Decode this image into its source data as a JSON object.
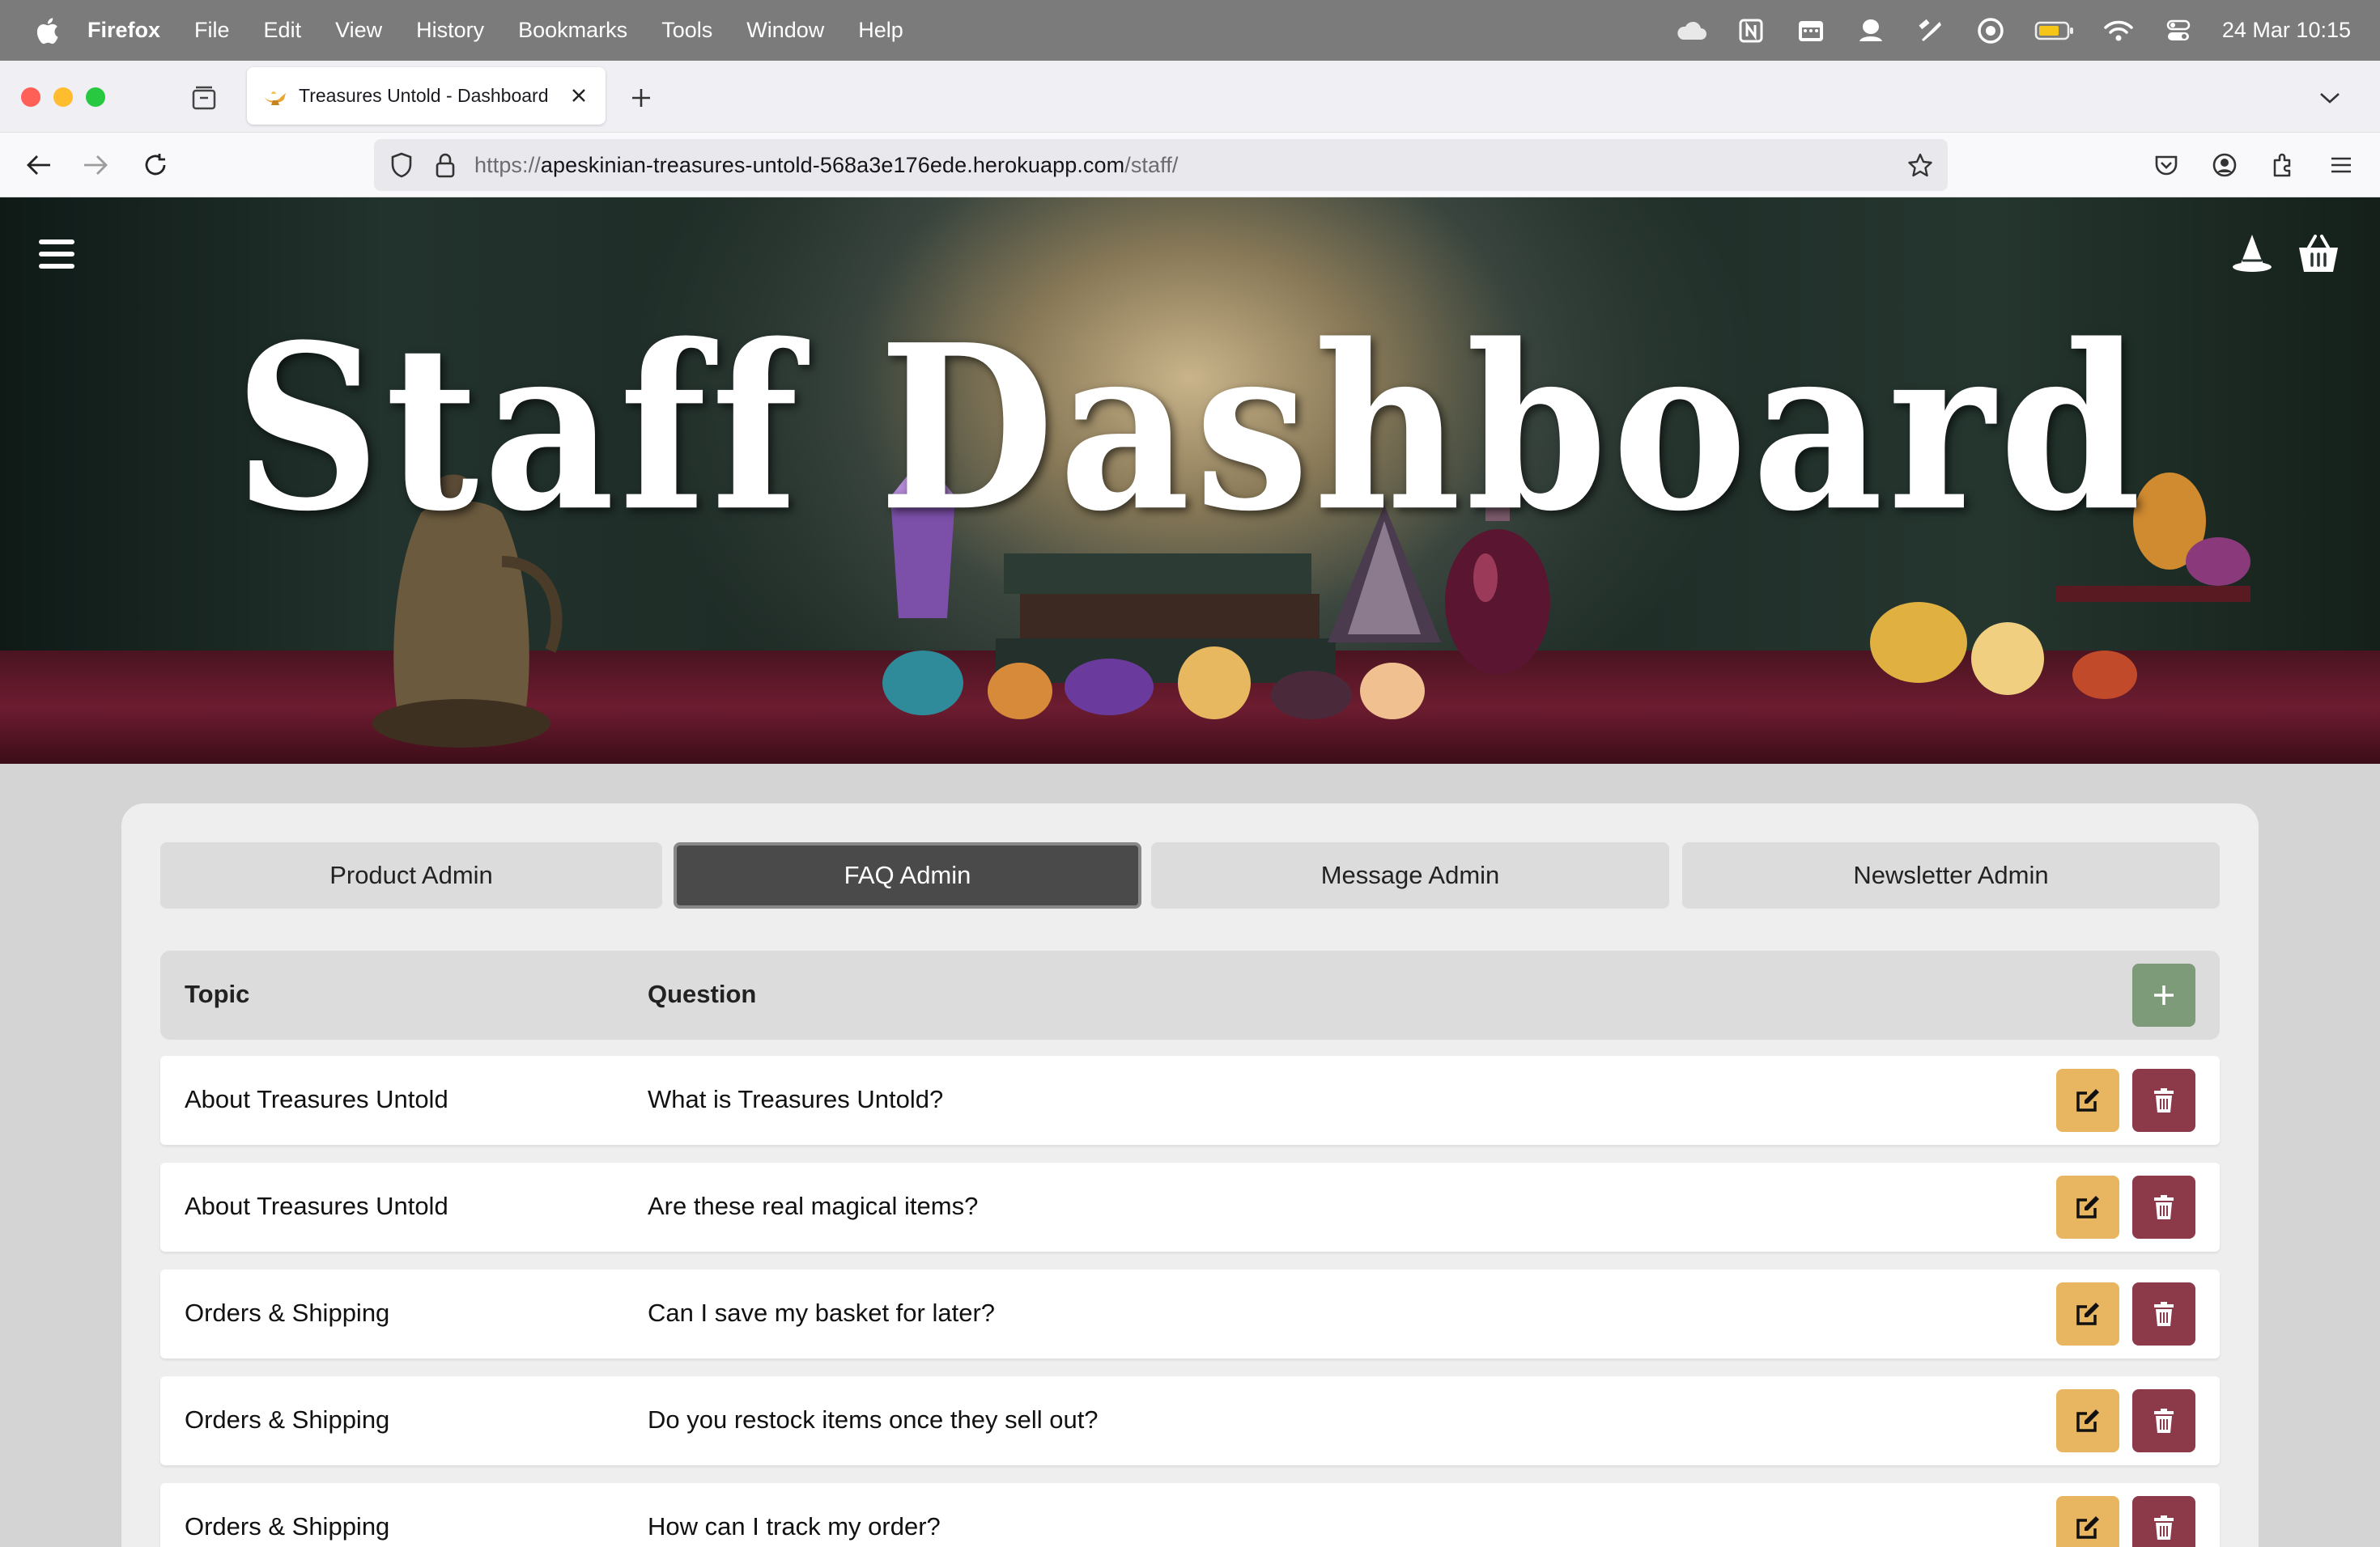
{
  "menubar": {
    "app": "Firefox",
    "items": [
      "File",
      "Edit",
      "View",
      "History",
      "Bookmarks",
      "Tools",
      "Window",
      "Help"
    ],
    "clock": "24 Mar  10:15"
  },
  "browser": {
    "tab_title": "Treasures Untold - Dashboard",
    "url_prefix": "https://",
    "url_host": "apeskinian-treasures-untold-568a3e176ede.herokuapp.com",
    "url_path": "/staff/"
  },
  "hero": {
    "title": "Staff Dashboard"
  },
  "admin_tabs": [
    {
      "label": "Product Admin",
      "active": false
    },
    {
      "label": "FAQ Admin",
      "active": true
    },
    {
      "label": "Message Admin",
      "active": false
    },
    {
      "label": "Newsletter Admin",
      "active": false
    }
  ],
  "table": {
    "headers": {
      "topic": "Topic",
      "question": "Question"
    },
    "rows": [
      {
        "topic": "About Treasures Untold",
        "question": "What is Treasures Untold?"
      },
      {
        "topic": "About Treasures Untold",
        "question": "Are these real magical items?"
      },
      {
        "topic": "Orders & Shipping",
        "question": "Can I save my basket for later?"
      },
      {
        "topic": "Orders & Shipping",
        "question": "Do you restock items once they sell out?"
      },
      {
        "topic": "Orders & Shipping",
        "question": "How can I track my order?"
      }
    ]
  },
  "colors": {
    "add": "#7d9b78",
    "edit": "#e8b660",
    "delete": "#8c3a4a",
    "active_tab": "#4a4a4a"
  }
}
